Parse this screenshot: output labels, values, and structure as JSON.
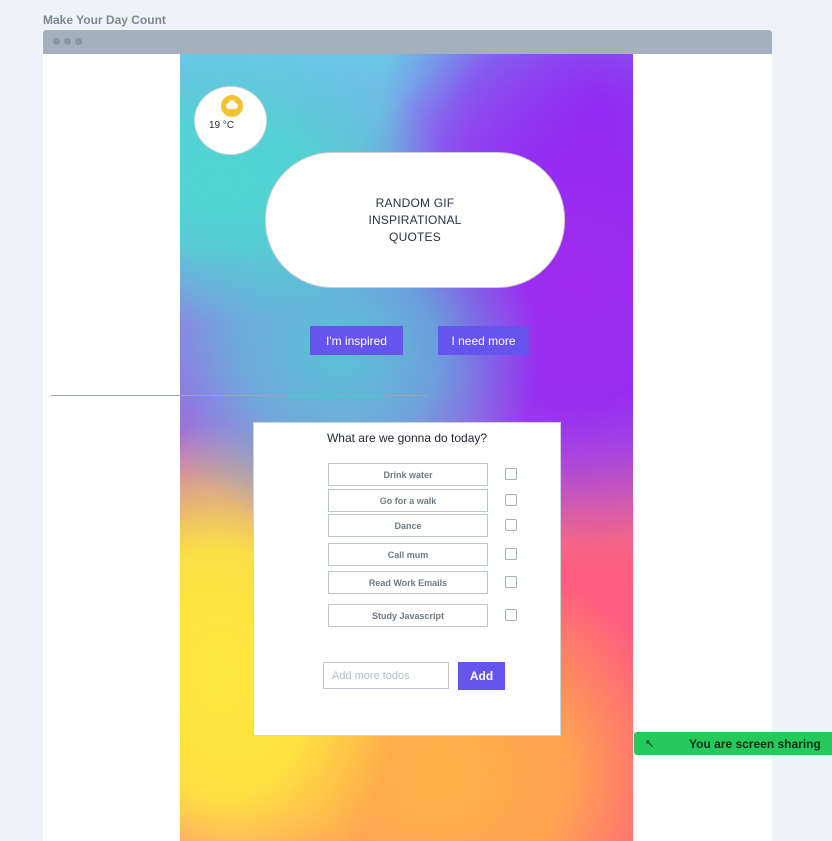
{
  "page": {
    "heading": "Make Your Day Count"
  },
  "weather": {
    "temperature": "19 °C",
    "icon": "sun-behind-cloud-icon"
  },
  "quote_bubble": {
    "line1": "RANDOM GIF",
    "line2": "INSPIRATIONAL",
    "line3": "QUOTES"
  },
  "buttons": {
    "inspired": "I'm inspired",
    "more": "I need more"
  },
  "todo": {
    "title": "What are we gonna do today?",
    "items": [
      {
        "label": "Drink water",
        "checked": false
      },
      {
        "label": "Go for a walk",
        "checked": false
      },
      {
        "label": "Dance",
        "checked": false
      },
      {
        "label": "Call mum",
        "checked": false
      },
      {
        "label": "Read Work Emails",
        "checked": false
      },
      {
        "label": "Study Javascript",
        "checked": false
      }
    ],
    "input_placeholder": "Add more todos",
    "add_label": "Add"
  },
  "share_banner": {
    "text": "You are screen sharing",
    "icon": "share-arrow-icon"
  },
  "colors": {
    "accent": "#6654ef",
    "share_green": "#26c95b"
  }
}
